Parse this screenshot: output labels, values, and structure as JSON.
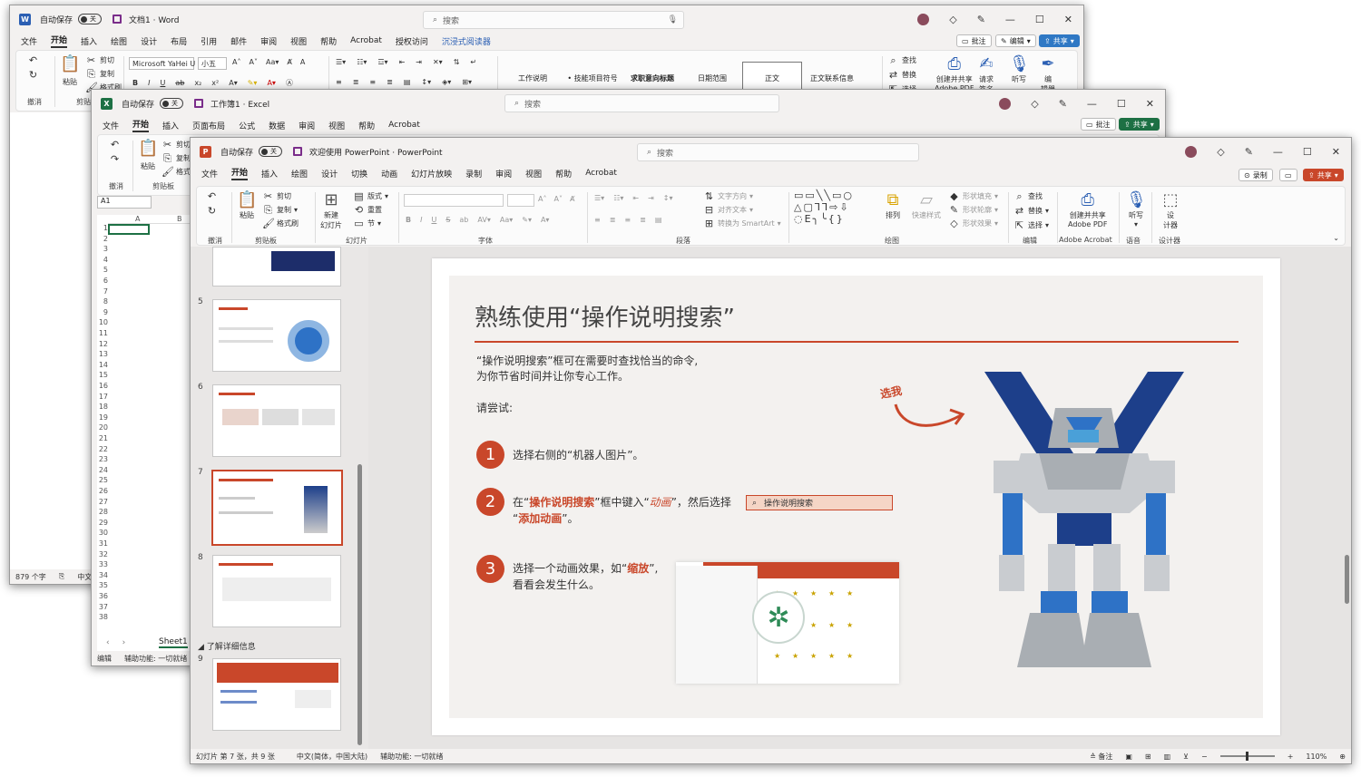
{
  "word": {
    "title": "文档1 · Word",
    "autosave": "自动保存",
    "toggle": "关",
    "search": "搜索",
    "tabs": [
      "文件",
      "开始",
      "插入",
      "绘图",
      "设计",
      "布局",
      "引用",
      "邮件",
      "审阅",
      "视图",
      "帮助",
      "Acrobat",
      "授权访问",
      "沉浸式阅读器"
    ],
    "active_tab": "开始",
    "comment": "批注",
    "edit": "编辑",
    "share": "共享",
    "undo": "撤消",
    "clipboard": "剪贴板",
    "paste": "粘贴",
    "cut": "剪切",
    "copy": "复制",
    "format_painter": "格式刷",
    "font_name": "Microsoft YaHei U",
    "font_size": "小五",
    "styles": [
      "工作说明",
      "• 技能项目符号",
      "求职意向标题",
      "日期范围",
      "正文",
      "正文联系信息"
    ],
    "find": "查找",
    "replace": "替换",
    "select": "选择",
    "adobe_create": "创建并共享",
    "adobe_pdf": "Adobe PDF",
    "request_sign": "请求",
    "sign": "签名",
    "dictate": "听写",
    "editor": "编",
    "editor2": "辑器",
    "status_words": "879 个字",
    "status_lang": "中文(中"
  },
  "excel": {
    "title": "工作簿1 · Excel",
    "autosave": "自动保存",
    "toggle": "关",
    "search": "搜索",
    "tabs": [
      "文件",
      "开始",
      "插入",
      "页面布局",
      "公式",
      "数据",
      "审阅",
      "视图",
      "帮助",
      "Acrobat"
    ],
    "active_tab": "开始",
    "comment": "批注",
    "share": "共享",
    "undo": "撤消",
    "clipboard": "剪贴板",
    "paste": "粘贴",
    "cut": "剪切",
    "copy": "复制",
    "format_painter": "格式刷",
    "name_box": "A1",
    "col_a": "A",
    "col_b": "B",
    "rows": [
      "1",
      "2",
      "3",
      "4",
      "5",
      "6",
      "7",
      "8",
      "9",
      "10",
      "11",
      "12",
      "13",
      "14",
      "15",
      "16",
      "17",
      "18",
      "19",
      "20",
      "21",
      "22",
      "23",
      "24",
      "25",
      "26",
      "27",
      "28",
      "29",
      "30",
      "31",
      "32",
      "33",
      "34",
      "35",
      "36",
      "37",
      "38"
    ],
    "sheet_tab": "Sheet1",
    "status_mode": "编辑",
    "status_access": "辅助功能: 一切就绪"
  },
  "ppt": {
    "title": "欢迎使用 PowerPoint · PowerPoint",
    "autosave": "自动保存",
    "toggle": "关",
    "search": "搜索",
    "tabs": [
      "文件",
      "开始",
      "插入",
      "绘图",
      "设计",
      "切换",
      "动画",
      "幻灯片放映",
      "录制",
      "审阅",
      "视图",
      "帮助",
      "Acrobat"
    ],
    "active_tab": "开始",
    "record": "录制",
    "share": "共享",
    "undo": "撤消",
    "clipboard": "剪贴板",
    "paste": "粘贴",
    "cut": "剪切",
    "copy": "复制",
    "format_painter": "格式刷",
    "slides_grp": "幻灯片",
    "new_slide": "新建",
    "new_slide2": "幻灯片",
    "layout": "版式",
    "reset": "重置",
    "section": "节",
    "font_grp": "字体",
    "para_grp": "段落",
    "draw_grp": "绘图",
    "edit_grp": "编辑",
    "acrobat_grp": "Adobe Acrobat",
    "voice_grp": "语音",
    "designer_grp": "设计器",
    "text_dir": "文字方向",
    "align_text": "对齐文本",
    "smartart": "转换为 SmartArt",
    "arrange": "排列",
    "quick_styles": "快速样式",
    "shape_fill": "形状填充",
    "shape_outline": "形状轮廓",
    "shape_effects": "形状效果",
    "find": "查找",
    "replace": "替换",
    "select": "选择",
    "adobe_create": "创建并共享",
    "adobe_pdf": "Adobe PDF",
    "dictate": "听写",
    "designer": "设",
    "designer2": "计器",
    "thumb_nums": [
      "5",
      "6",
      "7",
      "8",
      "9"
    ],
    "section_label": "了解详细信息",
    "slide": {
      "title": "熟练使用“操作说明搜索”",
      "intro1": "“操作说明搜索”框可在需要时查找恰当的命令,",
      "intro2": "为你节省时间并让你专心工作。",
      "try": "请尝试:",
      "pick": "选我",
      "s1_num": "1",
      "s1": "选择右侧的“机器人图片”。",
      "s2_num": "2",
      "s2_a": "在“",
      "s2_b": "操作说明搜索",
      "s2_c": "”框中键入“",
      "s2_d": "动画",
      "s2_e": "”，然后选择",
      "s2_f": "“",
      "s2_g": "添加动画",
      "s2_h": "”。",
      "search_box": "操作说明搜索",
      "s3_num": "3",
      "s3_a": "选择一个动画效果，如“",
      "s3_b": "缩放",
      "s3_c": "”,",
      "s3_d": "看看会发生什么。"
    },
    "status_slide": "幻灯片 第 7 张，共 9 张",
    "status_lang": "中文(简体，中国大陆)",
    "status_access": "辅助功能: 一切就绪",
    "status_notes": "备注",
    "zoom": "110%"
  },
  "colors": {
    "accent": "#c9472a",
    "word": "#2b5fb3",
    "excel": "#1d7044",
    "ppt": "#c9472a",
    "robot_navy": "#1d3f8a",
    "robot_blue": "#2e72c6"
  }
}
